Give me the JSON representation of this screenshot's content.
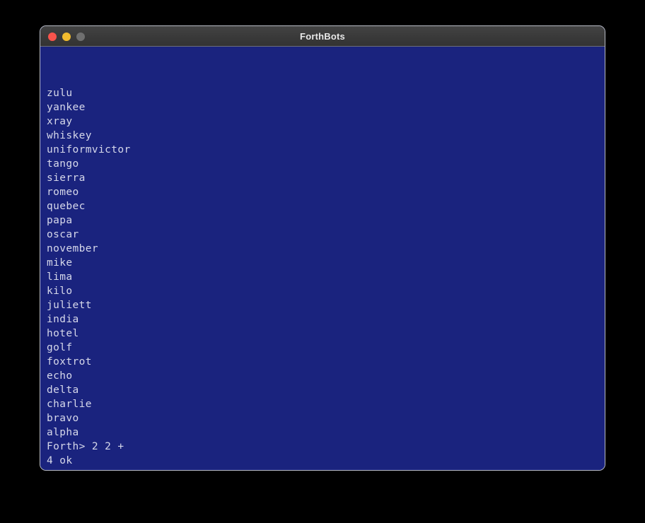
{
  "window": {
    "title": "ForthBots",
    "controls": {
      "close": "close-button",
      "minimize": "minimize-button",
      "zoom": "zoom-button"
    },
    "colors": {
      "desktop_background": "#000000",
      "titlebar": "#3a3a3a",
      "titlebar_text": "#e8e8e8",
      "terminal_background": "#1a237e",
      "terminal_text": "#d6d8ea",
      "window_border": "#b9bcc6",
      "close_light": "#f8544c",
      "minimize_light": "#f2bc2e",
      "zoom_light": "#6f6f6f"
    }
  },
  "terminal": {
    "lines": [
      "zulu",
      "yankee",
      "xray",
      "whiskey",
      "uniformvictor",
      "tango",
      "sierra",
      "romeo",
      "quebec",
      "papa",
      "oscar",
      "november",
      "mike",
      "lima",
      "kilo",
      "juliett",
      "india",
      "hotel",
      "golf",
      "foxtrot",
      "echo",
      "delta",
      "charlie",
      "bravo",
      "alpha",
      "Forth> 2 2 +",
      "4 ok"
    ],
    "prompt": "Forth>",
    "last_command": "2 2 +",
    "last_result": "4 ok"
  }
}
